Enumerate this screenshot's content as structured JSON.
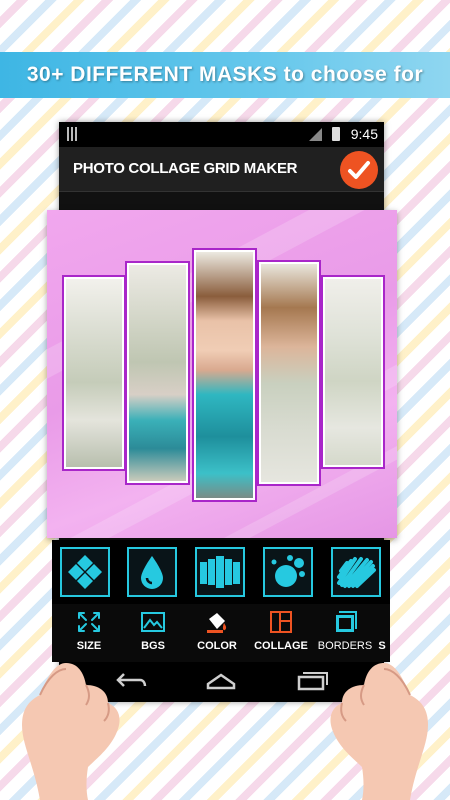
{
  "banner": {
    "text": "30+ DIFFERENT MASKS to choose for"
  },
  "status_bar": {
    "time": "9:45"
  },
  "app_bar": {
    "title": "PHOTO COLLAGE GRID MAKER"
  },
  "masks": [
    {
      "icon": "diamond-grid-icon"
    },
    {
      "icon": "drop-icon"
    },
    {
      "icon": "vertical-strips-icon"
    },
    {
      "icon": "bubbles-icon"
    },
    {
      "icon": "scribble-icon"
    }
  ],
  "bottom_menu": {
    "size": "SIZE",
    "bgs": "BGS",
    "color": "COLOR",
    "collage": "COLLAGE",
    "borders": "BORDERS",
    "partial": "S"
  },
  "colors": {
    "banner": "#4bbbe7",
    "accent": "#ee5322",
    "canvas": "#efa3ec",
    "frame": "#a926c9",
    "mask_icon": "#26c9e0"
  }
}
